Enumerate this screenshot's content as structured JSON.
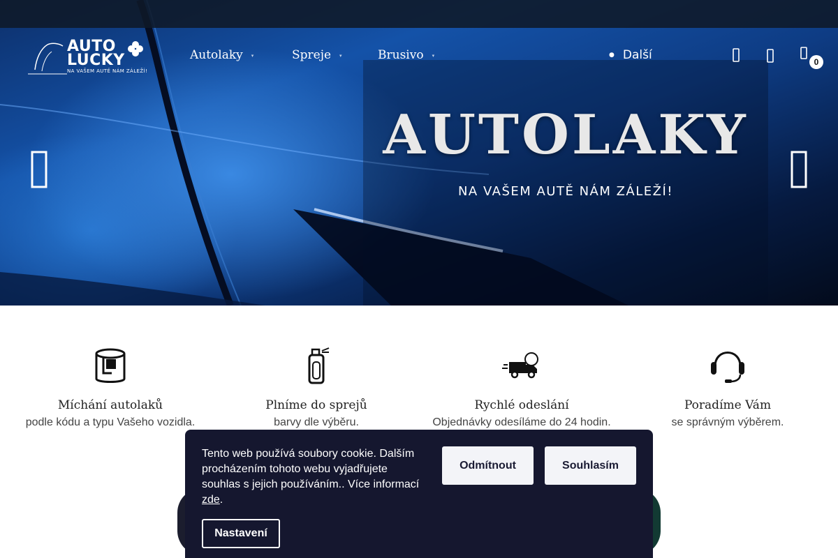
{
  "header": {
    "logo_line1": "AUTO",
    "logo_line2": "LUCKY",
    "logo_tagline": "NA VAŠEM AUTĚ NÁM ZÁLEŽÍ!",
    "nav": [
      {
        "label": "Autolaky"
      },
      {
        "label": "Spreje"
      },
      {
        "label": "Brusivo"
      }
    ],
    "more_label": "Další",
    "cart_count": "0",
    "icons": [
      "search-icon",
      "user-icon",
      "cart-icon"
    ]
  },
  "hero": {
    "title": "AUTOLAKY",
    "subtitle": "NA VAŠEM AUTĚ NÁM ZÁLEŽÍ!",
    "prev_icon": "chevron-left-icon",
    "next_icon": "chevron-right-icon",
    "colors": {
      "primary": "#1452a8",
      "dark": "#061a40"
    }
  },
  "features": [
    {
      "icon": "paint-bucket-icon",
      "title": "Míchání autolaků",
      "text": "podle kódu a typu Vašeho vozidla."
    },
    {
      "icon": "spray-can-icon",
      "title": "Plníme do sprejů",
      "text": "barvy dle výběru."
    },
    {
      "icon": "delivery-truck-icon",
      "title": "Rychlé odeslání",
      "text": "Objednávky odesíláme do 24 hodin."
    },
    {
      "icon": "headset-icon",
      "title": "Poradíme Vám",
      "text": "se správným výběrem."
    }
  ],
  "cookie": {
    "text": "Tento web používá soubory cookie. Dalším procházením tohoto webu vyjadřujete souhlas s jejich používáním.. Více informací",
    "link_label": "zde",
    "after_link": ".",
    "reject_label": "Odmítnout",
    "accept_label": "Souhlasím",
    "settings_label": "Nastavení",
    "background": "#15172f"
  }
}
